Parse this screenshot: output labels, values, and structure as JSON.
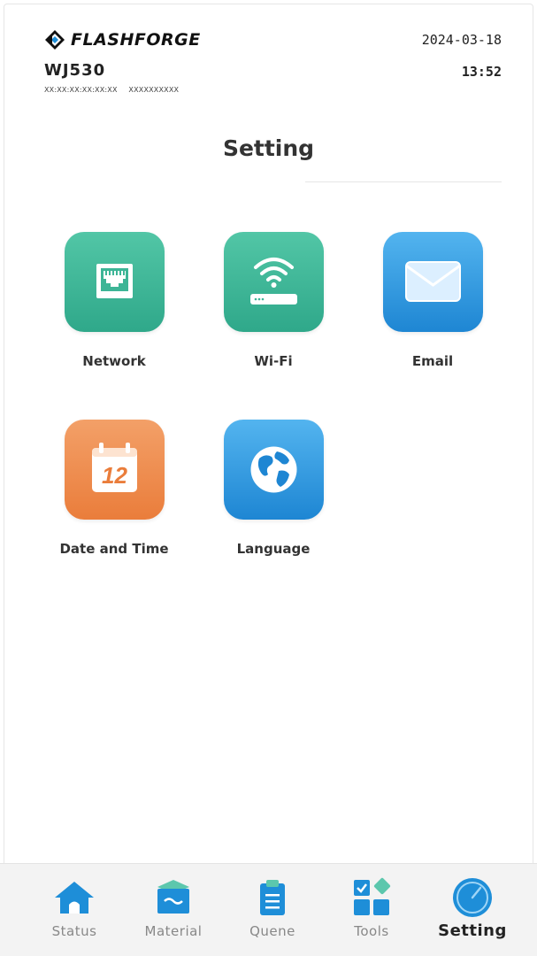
{
  "header": {
    "brand": "FLASHFORGE",
    "device_name": "WJ530",
    "device_id_1": "XX:XX:XX:XX:XX:XX",
    "device_id_2": "XXXXXXXXXX",
    "date": "2024-03-18",
    "time": "13:52"
  },
  "page": {
    "title": "Setting"
  },
  "settings": [
    {
      "label": "Network",
      "icon": "ethernet-icon",
      "color": "#3db596"
    },
    {
      "label": "Wi-Fi",
      "icon": "wifi-router-icon",
      "color": "#3db596"
    },
    {
      "label": "Email",
      "icon": "envelope-icon",
      "color": "#2b97e0"
    },
    {
      "label": "Date and Time",
      "icon": "calendar-icon",
      "calendar_day": "12",
      "color": "#ee8a4a"
    },
    {
      "label": "Language",
      "icon": "globe-icon",
      "color": "#2b97e0"
    }
  ],
  "nav": {
    "items": [
      {
        "label": "Status",
        "icon": "home-icon"
      },
      {
        "label": "Material",
        "icon": "material-icon"
      },
      {
        "label": "Quene",
        "icon": "clipboard-icon"
      },
      {
        "label": "Tools",
        "icon": "tools-grid-icon"
      },
      {
        "label": "Setting",
        "icon": "gauge-icon",
        "active": true
      }
    ],
    "accent_color": "#1e8ed8"
  }
}
